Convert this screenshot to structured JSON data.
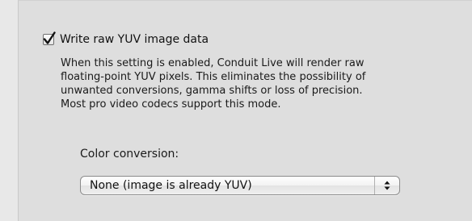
{
  "option": {
    "checked": true,
    "label": "Write raw YUV image data"
  },
  "description_lines": [
    "When this setting is enabled, Conduit Live will render raw",
    "floating-point YUV pixels. This eliminates the possibility of",
    "unwanted conversions, gamma shifts or loss of precision.",
    "Most pro video codecs support this mode."
  ],
  "color_conversion": {
    "label": "Color conversion:",
    "selected": "None (image is already YUV)"
  },
  "icons": {
    "checkmark": "checkmark-icon",
    "popup_arrows": "up-down-arrows-icon"
  },
  "colors": {
    "panel_background": "#dedede",
    "window_background": "#e8e8e8"
  }
}
